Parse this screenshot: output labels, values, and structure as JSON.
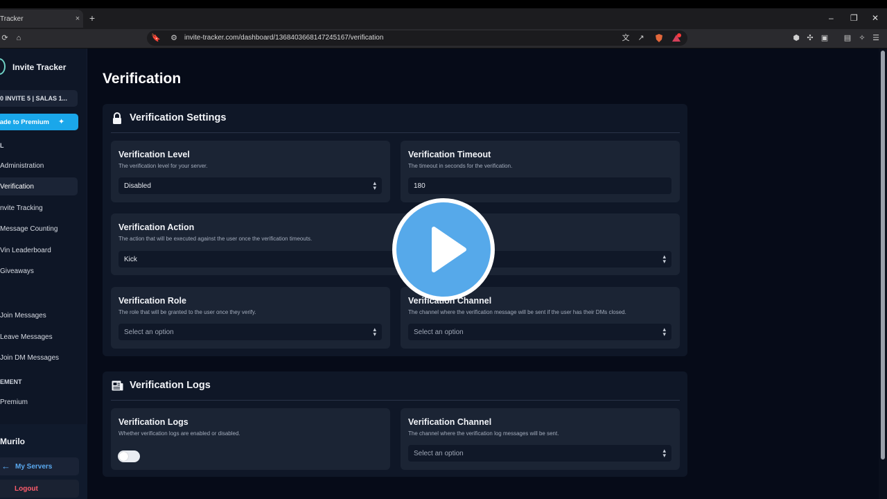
{
  "browser": {
    "tab_title": "Tracker",
    "tab_close": "×",
    "new_tab": "+",
    "url": "invite-tracker.com/dashboard/1368403668147245167/verification",
    "window_controls": [
      "–",
      "❐",
      "✕"
    ]
  },
  "sidebar": {
    "brand": "Invite Tracker",
    "server_name": "0 INVITE 5 | SALAS 1...",
    "premium_button": "rade to Premium",
    "sections": {
      "general": "L",
      "management": "EMENT"
    },
    "items": [
      {
        "label": "Administration"
      },
      {
        "label": "Verification"
      },
      {
        "label": "nvite Tracking"
      },
      {
        "label": "Message Counting"
      },
      {
        "label": "Vin Leaderboard"
      },
      {
        "label": "Giveaways"
      },
      {
        "label": "Join Messages"
      },
      {
        "label": "Leave Messages"
      },
      {
        "label": "Join DM Messages"
      },
      {
        "label": "Premium"
      }
    ],
    "user_name": "Murilo",
    "my_servers": "My Servers",
    "logout": "Logout"
  },
  "main": {
    "title": "Verification",
    "settings_panel": {
      "title": "Verification Settings",
      "cards": {
        "level": {
          "title": "Verification Level",
          "desc": "The verification level for your server.",
          "value": "Disabled"
        },
        "timeout": {
          "title": "Verification Timeout",
          "desc": "The timeout in seconds for the verification.",
          "value": "180"
        },
        "action": {
          "title": "Verification Action",
          "desc": "The action that will be executed against the user once the verification timeouts.",
          "value": "Kick"
        },
        "role": {
          "title": "Verification Role",
          "desc": "The role that will be granted to the user once they verify.",
          "placeholder": "Select an option"
        },
        "channel": {
          "title": "Verification Channel",
          "desc": "The channel where the verification message will be sent if the user has their DMs closed.",
          "placeholder": "Select an option"
        }
      }
    },
    "logs_panel": {
      "title": "Verification Logs",
      "cards": {
        "logs": {
          "title": "Verification Logs",
          "desc": "Whether verification logs are enabled or disabled.",
          "enabled": false
        },
        "channel": {
          "title": "Verification Channel",
          "desc": "The channel where the verification log messages will be sent.",
          "placeholder": "Select an option"
        }
      }
    }
  },
  "colors": {
    "accent": "#1aa7ea",
    "logout": "#ff5c6c",
    "play_button": "#56a9ea"
  }
}
